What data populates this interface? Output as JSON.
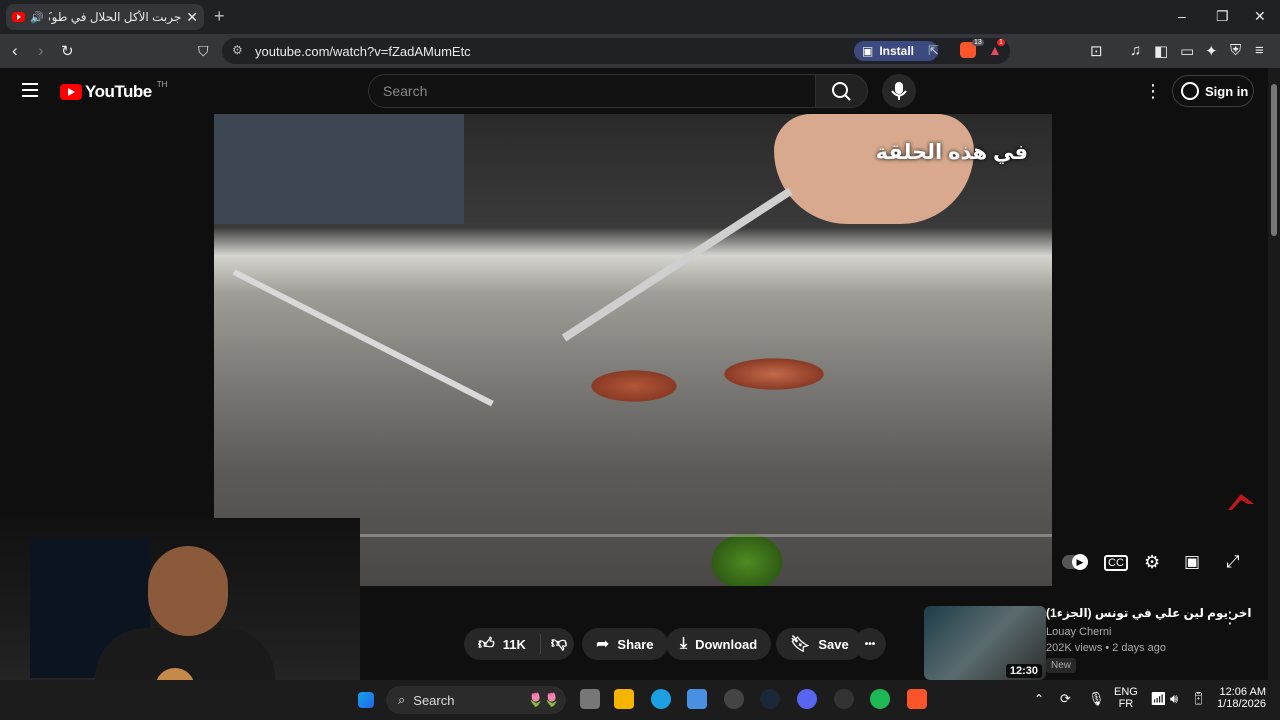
{
  "browser": {
    "tab_title": "جربت الأكل الحلال في طوكيو ال",
    "tab_close": "✕",
    "new_tab": "+",
    "url": "youtube.com/watch?v=fZadAMumEtc",
    "install_label": "Install",
    "window_controls": {
      "minimize": "–",
      "maximize": "❐",
      "close": "✕"
    },
    "brave_shield_count": "13",
    "rewards_count": "1"
  },
  "youtube": {
    "logo_text": "YouTube",
    "country_code": "TH",
    "search_placeholder": "Search",
    "signin_label": "Sign in"
  },
  "video": {
    "subtitle": "في هذه الحلقة",
    "progress_fraction": 0.0
  },
  "actions": {
    "like_count": "11K",
    "share_label": "Share",
    "download_label": "Download",
    "save_label": "Save",
    "more_label": "•••"
  },
  "recommendation": {
    "title": "اخر يوم لين علي في تونس (الجزء1)",
    "channel": "Louay Cherni",
    "meta": "202K views • 2 days ago",
    "badge": "New",
    "duration": "12:30"
  },
  "taskbar": {
    "search_label": "Search",
    "lang_top": "ENG",
    "lang_bottom": "FR",
    "time": "12:06 AM",
    "date": "1/18/2026"
  },
  "colors": {
    "youtube_red": "#ff0000",
    "background": "#0f0f0f",
    "pill": "#272727"
  }
}
